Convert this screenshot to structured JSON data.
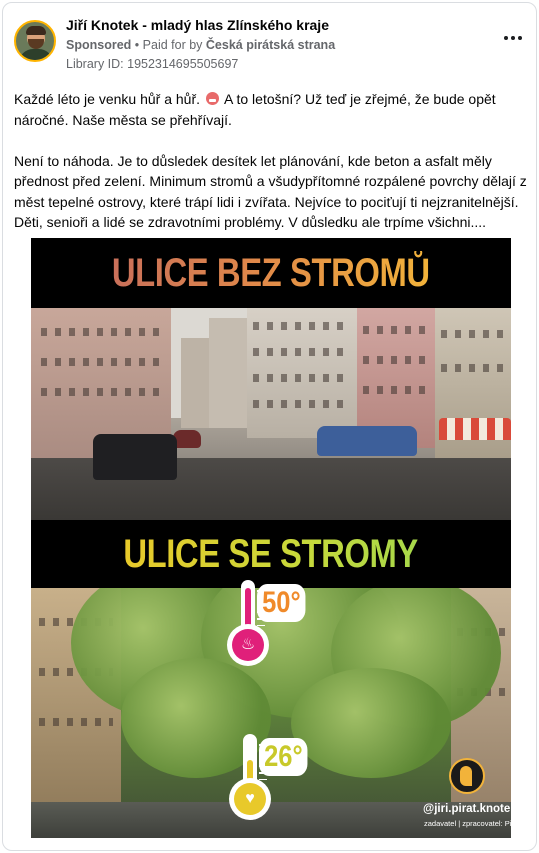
{
  "post": {
    "page_name": "Jiří Knotek - mladý hlas Zlínského kraje",
    "sponsored": "Sponsored",
    "separator": "•",
    "paid_for_by": "Paid for by",
    "payer": "Česká pirátská strana",
    "library_id": "Library ID: 1952314695505697",
    "paragraph_1a": "Každé léto je venku hůř a hůř.",
    "paragraph_1b": "A to letošní? Už teď je zřejmé, že bude opět náročné. Naše města se přehřívají.",
    "paragraph_2": "Není to náhoda. Je to důsledek desítek let plánování, kde beton a asfalt měly přednost před zelení. Minimum stromů a všudypřítomné rozpálené povrchy dělají z měst tepelné ostrovy, které trápí lidi i zvířata. Nejvíce to pociťují ti nejzranitelnější. Děti, senioři a lidé se zdravotními problémy. V důsledku ale trpíme všichni...."
  },
  "creative": {
    "title_top": "ULICE BEZ STROMŮ",
    "title_bottom": "ULICE SE STROMY",
    "temp_hot": "50°",
    "temp_cool": "26°",
    "handle": "@jiri.pirat.knotek",
    "credits": "zadavatel | zpracovatel: Piráti"
  },
  "icons": {
    "more": "more-horizontal-icon",
    "emoji": "angry-face-emoji-icon",
    "flame": "flame-icon",
    "heart": "heart-icon"
  },
  "colors": {
    "meta_gray": "#65676b",
    "hot": "#e0207a",
    "cool": "#e8c92a",
    "accent_orange": "#f08a2a"
  }
}
